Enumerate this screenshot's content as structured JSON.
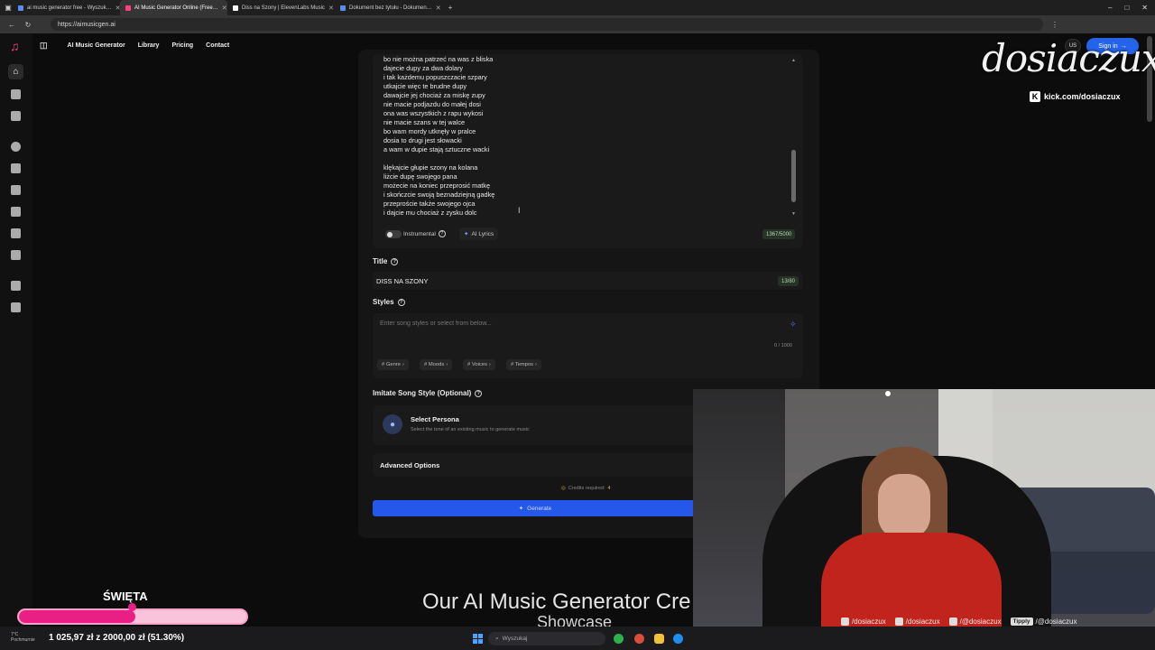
{
  "browser": {
    "tabs": [
      {
        "label": "ai music generator free - Wyszuk…",
        "color": "#4285f4",
        "active": false
      },
      {
        "label": "AI Music Generator Online (Free…",
        "color": "#ff3f7f",
        "active": true
      },
      {
        "label": "Diss na Szony | ElevenLabs Music",
        "color": "#ffffff",
        "active": false
      },
      {
        "label": "Dokument bez tytułu - Dokumen…",
        "color": "#4a86f7",
        "active": false
      }
    ],
    "new_tab": "+",
    "url": "https://aimusicgen.ai",
    "controls": {
      "minimize": "–",
      "maximize": "□",
      "close": "✕"
    }
  },
  "nav": {
    "items": [
      "AI Music Generator",
      "Library",
      "Pricing",
      "Contact"
    ],
    "menu_icon": "sidebar-toggle-icon"
  },
  "header_right": {
    "lang": "US",
    "signin": "Sign in",
    "signin_arrow": "→"
  },
  "sidebar": {
    "icons": [
      "music-note-icon",
      "folder-icon",
      "disc-icon",
      "waveform-icon",
      "video-icon",
      "document-icon",
      "send-icon",
      "book-icon",
      "tag-icon",
      "mail-icon"
    ]
  },
  "lyrics": {
    "lines": [
      "bo nie można patrzeć na was z bliska",
      "dajecie dupy za dwa dolary",
      "i tak każdemu popuszczacie szpary",
      "utkajcie więc te brudne dupy",
      "dawajcie jej chociaż za miskę zupy",
      "nie macie podjazdu do małej dosi",
      "ona was wszystkich z rapu wykosi",
      "nie macie szans w tej walce",
      "bo wam mordy utknęły w pralce",
      "dosia to drugi jest słowacki",
      "a wam w dupie stają sztuczne wacki",
      "",
      "klękajcie głupie szony na kolana",
      "liżcie dupę swojego pana",
      "możecie na koniec przeprosić matkę",
      "i skończcie swoją beznadziejną gadkę",
      "przeproście także swojego ojca",
      "i dajcie mu chociaż z zysku dolc"
    ],
    "instrumental_label": "Instrumental",
    "ai_lyrics_label": "AI Lyrics",
    "char_count": "1367/5000"
  },
  "title_section": {
    "label": "Title",
    "value": "DISS NA SZONY",
    "count": "13/80"
  },
  "styles_section": {
    "label": "Styles",
    "placeholder": "Enter song styles or select from below...",
    "count": "0 / 1000",
    "tags": [
      "# Genre",
      "# Moods",
      "# Voices",
      "# Tempos"
    ]
  },
  "imitate": {
    "label": "Imitate Song Style (Optional)",
    "persona_title": "Select Persona",
    "persona_sub": "Select the tone of an existing music to generate music"
  },
  "advanced": {
    "label": "Advanced Options"
  },
  "credits": {
    "label": "Credits required:",
    "value": "4"
  },
  "generate": {
    "label": "Generate"
  },
  "showcase": {
    "line1": "Our AI Music Generator Cre",
    "line2": "Showcase"
  },
  "overlay": {
    "brand": "dosiaczux",
    "kick": "kick.com/dosiaczux",
    "socials": [
      {
        "icon": "instagram-icon",
        "handle": "/dosiaczux"
      },
      {
        "icon": "tiktok-icon",
        "handle": "/dosiaczux"
      },
      {
        "icon": "youtube-icon",
        "handle": "/@dosiaczux"
      }
    ],
    "tipply": {
      "badge": "Tipply",
      "handle": "/@dosiaczux"
    }
  },
  "goal": {
    "label": "ŚWIĘTA",
    "progress": 0.513,
    "text": "1 025,97 zł z 2000,00 zł (51.30%)"
  },
  "taskbar": {
    "weather": [
      "7°C",
      "Pochmurnie"
    ],
    "search_placeholder": "Wyszukaj"
  },
  "colors": {
    "accent": "#2563eb",
    "goal_fill": "#ea1f86",
    "brand_pink": "#ff3f7f"
  }
}
